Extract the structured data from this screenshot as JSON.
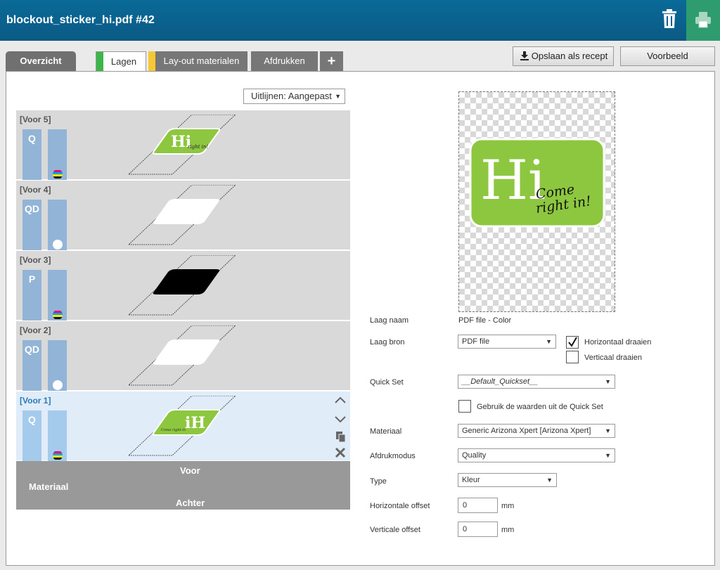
{
  "header": {
    "title": "blockout_sticker_hi.pdf #42"
  },
  "tabs": [
    {
      "label": "Overzicht"
    },
    {
      "label": "Lagen",
      "color": "#3db54a"
    },
    {
      "label": "Lay-out materialen",
      "color": "#f6c833"
    },
    {
      "label": "Afdrukken"
    },
    {
      "label": "+"
    }
  ],
  "toolbar": {
    "save_label": "Opslaan als recept",
    "preview_label": "Voorbeeld"
  },
  "align": {
    "value": "Uitlijnen: Aangepast"
  },
  "layers": [
    {
      "name": "[Voor 5]",
      "mode": "Q",
      "ink": "cmyk",
      "thumb": "color"
    },
    {
      "name": "[Voor 4]",
      "mode": "QD",
      "ink": "white",
      "thumb": "white"
    },
    {
      "name": "[Voor 3]",
      "mode": "P",
      "ink": "cmyk",
      "thumb": "black"
    },
    {
      "name": "[Voor 2]",
      "mode": "QD",
      "ink": "white",
      "thumb": "white"
    },
    {
      "name": "[Voor 1]",
      "mode": "Q",
      "ink": "cmyk",
      "thumb": "color-mirrored",
      "active": true
    }
  ],
  "material": {
    "front": "Voor",
    "label": "Materiaal",
    "back": "Achter"
  },
  "preview": {
    "logo_text": "Hi",
    "tagline_1": "Come",
    "tagline_2": "right in!",
    "logo_color": "#8dc63f"
  },
  "form": {
    "layer_name_label": "Laag naam",
    "layer_name_value": "PDF file - Color",
    "layer_source_label": "Laag bron",
    "layer_source_value": "PDF file",
    "flip_h_label": "Horizontaal draaien",
    "flip_h_checked": true,
    "flip_v_label": "Verticaal draaien",
    "flip_v_checked": false,
    "quickset_label": "Quick Set",
    "quickset_value": "__Default_Quickset__",
    "use_quickset_label": "Gebruik de waarden uit de Quick Set",
    "use_quickset_checked": false,
    "material_label": "Materiaal",
    "material_value": "Generic Arizona Xpert [Arizona Xpert]",
    "print_mode_label": "Afdrukmodus",
    "print_mode_value": "Quality",
    "type_label": "Type",
    "type_value": "Kleur",
    "h_offset_label": "Horizontale offset",
    "h_offset_value": "0",
    "h_offset_unit": "mm",
    "v_offset_label": "Verticale offset",
    "v_offset_value": "0",
    "v_offset_unit": "mm"
  }
}
